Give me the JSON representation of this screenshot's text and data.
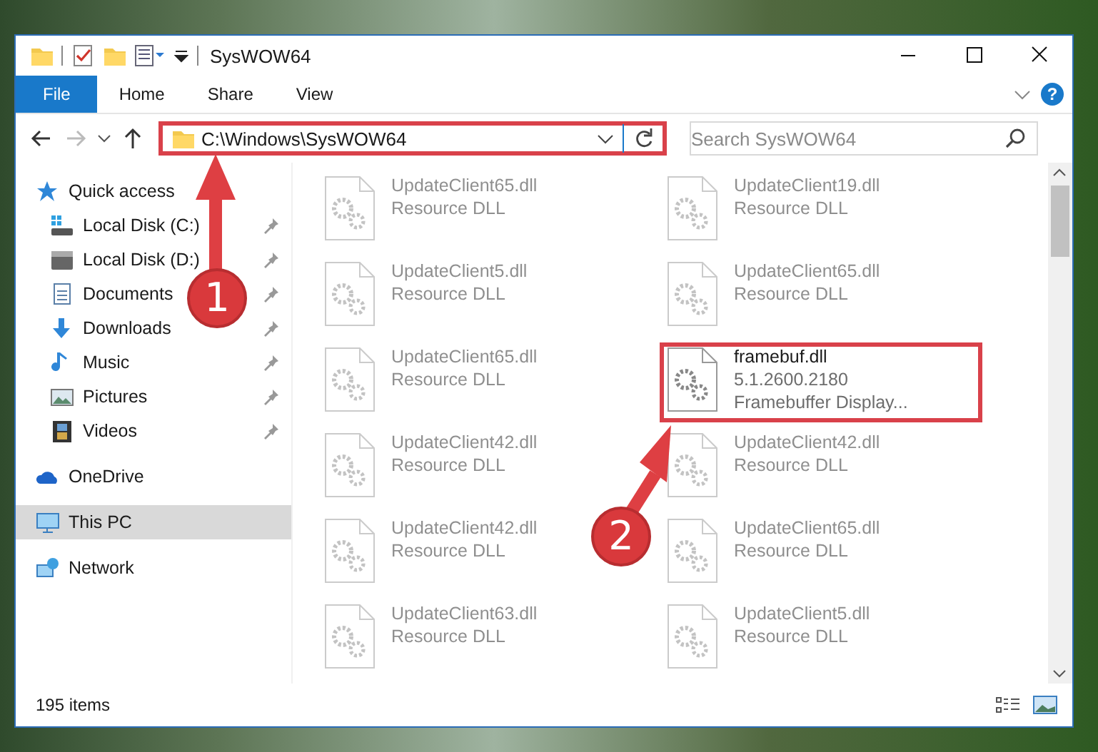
{
  "window": {
    "title": "SysWOW64"
  },
  "ribbon": {
    "tabs": [
      {
        "label": "File",
        "selected": true
      },
      {
        "label": "Home",
        "selected": false
      },
      {
        "label": "Share",
        "selected": false
      },
      {
        "label": "View",
        "selected": false
      }
    ],
    "help": "?"
  },
  "address": {
    "path": "C:\\Windows\\SysWOW64",
    "highlighted": true
  },
  "search": {
    "placeholder": "Search SysWOW64"
  },
  "sidebar": {
    "items": [
      {
        "label": "Quick access",
        "kind": "star",
        "selected": false,
        "children": [
          {
            "label": "Local Disk (C:)",
            "kind": "system-drive",
            "pinned": true,
            "selected": false
          },
          {
            "label": "Local Disk (D:)",
            "kind": "drive",
            "pinned": true,
            "selected": false
          },
          {
            "label": "Documents",
            "kind": "documents",
            "pinned": true,
            "selected": false
          },
          {
            "label": "Downloads",
            "kind": "downloads",
            "pinned": true,
            "selected": false
          },
          {
            "label": "Music",
            "kind": "music",
            "pinned": true,
            "selected": false
          },
          {
            "label": "Pictures",
            "kind": "pictures",
            "pinned": true,
            "selected": false
          },
          {
            "label": "Videos",
            "kind": "videos",
            "pinned": true,
            "selected": false
          }
        ]
      },
      {
        "label": "OneDrive",
        "kind": "cloud",
        "selected": false
      },
      {
        "label": "This PC",
        "kind": "pc",
        "selected": true
      },
      {
        "label": "Network",
        "kind": "network",
        "selected": false
      }
    ]
  },
  "files": [
    {
      "name": "UpdateClient65.dll",
      "details": [
        "Resource DLL"
      ],
      "faded": true,
      "highlighted": false
    },
    {
      "name": "UpdateClient19.dll",
      "details": [
        "Resource DLL"
      ],
      "faded": true,
      "highlighted": false
    },
    {
      "name": "UpdateClient5.dll",
      "details": [
        "Resource DLL"
      ],
      "faded": true,
      "highlighted": false
    },
    {
      "name": "UpdateClient65.dll",
      "details": [
        "Resource DLL"
      ],
      "faded": true,
      "highlighted": false
    },
    {
      "name": "UpdateClient65.dll",
      "details": [
        "Resource DLL"
      ],
      "faded": true,
      "highlighted": false
    },
    {
      "name": "framebuf.dll",
      "details": [
        "5.1.2600.2180",
        "Framebuffer Display..."
      ],
      "faded": false,
      "highlighted": true
    },
    {
      "name": "UpdateClient42.dll",
      "details": [
        "Resource DLL"
      ],
      "faded": true,
      "highlighted": false
    },
    {
      "name": "UpdateClient42.dll",
      "details": [
        "Resource DLL"
      ],
      "faded": true,
      "highlighted": false
    },
    {
      "name": "UpdateClient42.dll",
      "details": [
        "Resource DLL"
      ],
      "faded": true,
      "highlighted": false
    },
    {
      "name": "UpdateClient65.dll",
      "details": [
        "Resource DLL"
      ],
      "faded": true,
      "highlighted": false
    },
    {
      "name": "UpdateClient63.dll",
      "details": [
        "Resource DLL"
      ],
      "faded": true,
      "highlighted": false
    },
    {
      "name": "UpdateClient5.dll",
      "details": [
        "Resource DLL"
      ],
      "faded": true,
      "highlighted": false
    }
  ],
  "status_bar": {
    "count": "195 items"
  },
  "callouts": [
    {
      "number": "1"
    },
    {
      "number": "2"
    }
  ]
}
